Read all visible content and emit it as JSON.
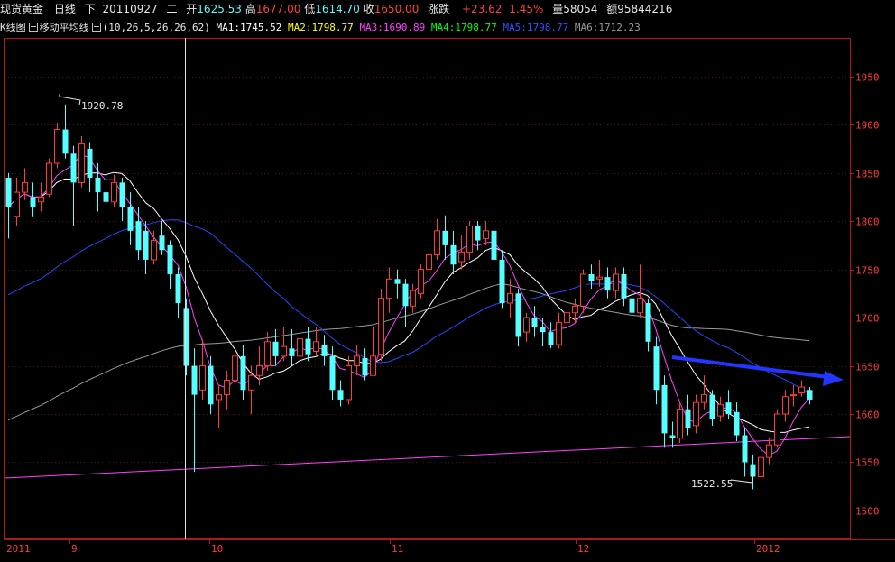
{
  "header": {
    "instrument": "现货黄金",
    "period": "日线",
    "direction": "下",
    "date": "20110927",
    "weekday": "二",
    "open_label": "开",
    "open": "1625.53",
    "high_label": "高",
    "high": "1677.00",
    "low_label": "低",
    "low": "1614.70",
    "close_label": "收",
    "close": "1650.00",
    "change_label": "涨跌",
    "change": "+23.62",
    "change_pct": "1.45%",
    "volume_label": "量",
    "volume": "58054",
    "amount_label": "额",
    "amount": "95844216"
  },
  "indicator": {
    "chart_label": "K线图",
    "ma_label": "移动平均线",
    "params": "(10,26,5,26,26,62)",
    "ma1": "MA1:1745.52",
    "ma2": "MA2:1798.77",
    "ma3": "MA3:1690.89",
    "ma4": "MA4:1798.77",
    "ma5": "MA5:1798.77",
    "ma6": "MA6:1712.23"
  },
  "colors": {
    "up": "#ff3c3c",
    "down": "#54ffff",
    "ma_white": "#ffffff",
    "ma_yellow": "#ffff00",
    "ma_magenta": "#ff40ff",
    "ma_green": "#00ff00",
    "ma_blue": "#2b45ff",
    "ma_gray": "#9a9a9a",
    "frame": "#b01818",
    "arrow": "#2236ff"
  },
  "annotations": {
    "high_label": "1920.78",
    "low_label": "1522.55"
  },
  "chart_data": {
    "type": "candlestick",
    "y_axis": {
      "ticks": [
        1500,
        1550,
        1600,
        1650,
        1700,
        1750,
        1800,
        1850,
        1900,
        1950
      ],
      "range": [
        1470,
        1990
      ]
    },
    "x_axis": {
      "labels": [
        "2011",
        "9",
        "10",
        "11",
        "12",
        "2012"
      ]
    },
    "candles": [
      [
        1845,
        1815,
        1850,
        1782
      ],
      [
        1805,
        1830,
        1845,
        1795
      ],
      [
        1830,
        1840,
        1855,
        1822
      ],
      [
        1825,
        1815,
        1840,
        1805
      ],
      [
        1820,
        1825,
        1840,
        1810
      ],
      [
        1828,
        1860,
        1865,
        1825
      ],
      [
        1860,
        1895,
        1902,
        1855
      ],
      [
        1895,
        1870,
        1921,
        1865
      ],
      [
        1870,
        1840,
        1878,
        1795
      ],
      [
        1840,
        1880,
        1888,
        1835
      ],
      [
        1875,
        1845,
        1882,
        1830
      ],
      [
        1845,
        1830,
        1860,
        1810
      ],
      [
        1830,
        1820,
        1850,
        1815
      ],
      [
        1820,
        1840,
        1848,
        1815
      ],
      [
        1840,
        1815,
        1845,
        1800
      ],
      [
        1815,
        1790,
        1830,
        1775
      ],
      [
        1800,
        1770,
        1815,
        1760
      ],
      [
        1790,
        1760,
        1800,
        1745
      ],
      [
        1760,
        1780,
        1790,
        1755
      ],
      [
        1785,
        1770,
        1800,
        1765
      ],
      [
        1775,
        1745,
        1780,
        1730
      ],
      [
        1745,
        1715,
        1752,
        1700
      ],
      [
        1710,
        1650,
        1720,
        1640
      ],
      [
        1650,
        1620,
        1668,
        1540
      ],
      [
        1625,
        1650,
        1677,
        1615
      ],
      [
        1650,
        1610,
        1660,
        1600
      ],
      [
        1615,
        1620,
        1630,
        1585
      ],
      [
        1620,
        1635,
        1645,
        1605
      ],
      [
        1635,
        1660,
        1670,
        1630
      ],
      [
        1660,
        1625,
        1672,
        1615
      ],
      [
        1625,
        1640,
        1650,
        1600
      ],
      [
        1640,
        1650,
        1670,
        1630
      ],
      [
        1650,
        1675,
        1685,
        1645
      ],
      [
        1675,
        1660,
        1688,
        1650
      ],
      [
        1660,
        1670,
        1690,
        1655
      ],
      [
        1668,
        1660,
        1688,
        1650
      ],
      [
        1660,
        1678,
        1690,
        1650
      ],
      [
        1678,
        1662,
        1690,
        1655
      ],
      [
        1665,
        1675,
        1690,
        1660
      ],
      [
        1672,
        1660,
        1682,
        1650
      ],
      [
        1660,
        1625,
        1670,
        1615
      ],
      [
        1625,
        1615,
        1635,
        1608
      ],
      [
        1615,
        1650,
        1660,
        1610
      ],
      [
        1650,
        1660,
        1672,
        1640
      ],
      [
        1658,
        1640,
        1668,
        1635
      ],
      [
        1640,
        1660,
        1690,
        1640
      ],
      [
        1662,
        1720,
        1730,
        1655
      ],
      [
        1720,
        1740,
        1752,
        1705
      ],
      [
        1740,
        1735,
        1750,
        1720
      ],
      [
        1735,
        1712,
        1740,
        1690
      ],
      [
        1712,
        1728,
        1735,
        1705
      ],
      [
        1725,
        1750,
        1755,
        1720
      ],
      [
        1750,
        1765,
        1772,
        1740
      ],
      [
        1765,
        1790,
        1802,
        1760
      ],
      [
        1790,
        1775,
        1806,
        1760
      ],
      [
        1775,
        1755,
        1790,
        1745
      ],
      [
        1758,
        1768,
        1785,
        1750
      ],
      [
        1768,
        1795,
        1800,
        1760
      ],
      [
        1795,
        1780,
        1800,
        1770
      ],
      [
        1782,
        1790,
        1800,
        1775
      ],
      [
        1790,
        1760,
        1795,
        1740
      ],
      [
        1760,
        1715,
        1770,
        1710
      ],
      [
        1715,
        1725,
        1740,
        1700
      ],
      [
        1725,
        1680,
        1730,
        1670
      ],
      [
        1685,
        1700,
        1705,
        1675
      ],
      [
        1700,
        1690,
        1712,
        1680
      ],
      [
        1690,
        1685,
        1700,
        1670
      ],
      [
        1685,
        1672,
        1695,
        1668
      ],
      [
        1672,
        1695,
        1705,
        1668
      ],
      [
        1695,
        1705,
        1715,
        1690
      ],
      [
        1705,
        1712,
        1720,
        1695
      ],
      [
        1712,
        1745,
        1750,
        1705
      ],
      [
        1745,
        1738,
        1755,
        1730
      ],
      [
        1740,
        1742,
        1760,
        1732
      ],
      [
        1742,
        1728,
        1752,
        1720
      ],
      [
        1728,
        1745,
        1752,
        1720
      ],
      [
        1745,
        1720,
        1752,
        1712
      ],
      [
        1720,
        1705,
        1725,
        1700
      ],
      [
        1705,
        1720,
        1755,
        1700
      ],
      [
        1715,
        1675,
        1720,
        1665
      ],
      [
        1670,
        1625,
        1680,
        1610
      ],
      [
        1630,
        1580,
        1640,
        1565
      ],
      [
        1578,
        1575,
        1592,
        1565
      ],
      [
        1575,
        1605,
        1612,
        1570
      ],
      [
        1605,
        1585,
        1620,
        1578
      ],
      [
        1588,
        1612,
        1620,
        1580
      ],
      [
        1612,
        1620,
        1640,
        1605
      ],
      [
        1620,
        1595,
        1625,
        1588
      ],
      [
        1598,
        1610,
        1618,
        1592
      ],
      [
        1612,
        1600,
        1625,
        1595
      ],
      [
        1602,
        1578,
        1612,
        1572
      ],
      [
        1578,
        1550,
        1585,
        1535
      ],
      [
        1548,
        1535,
        1558,
        1522
      ],
      [
        1535,
        1555,
        1565,
        1530
      ],
      [
        1555,
        1568,
        1575,
        1548
      ],
      [
        1568,
        1600,
        1605,
        1565
      ],
      [
        1600,
        1618,
        1625,
        1592
      ],
      [
        1620,
        1620,
        1630,
        1608
      ],
      [
        1622,
        1628,
        1635,
        1618
      ],
      [
        1625,
        1615,
        1628,
        1610
      ]
    ]
  }
}
